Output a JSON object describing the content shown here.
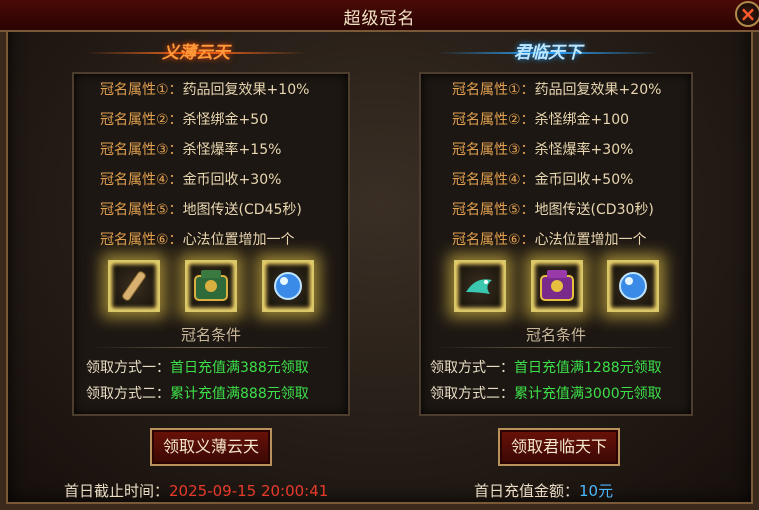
{
  "window": {
    "title": "超级冠名",
    "close_icon": "×"
  },
  "left": {
    "title": "义薄云天",
    "attributes": [
      {
        "label": "冠名属性①：",
        "value": "药品回复效果+10%"
      },
      {
        "label": "冠名属性②：",
        "value": "杀怪绑金+50"
      },
      {
        "label": "冠名属性③：",
        "value": "杀怪爆率+15%"
      },
      {
        "label": "冠名属性④：",
        "value": "金币回收+30%"
      },
      {
        "label": "冠名属性⑤：",
        "value": "地图传送(CD45秒)"
      },
      {
        "label": "冠名属性⑥：",
        "value": "心法位置增加一个"
      }
    ],
    "items": [
      "scroll-item-icon",
      "armor-chest-item-icon",
      "blue-orb-item-icon"
    ],
    "condition_title": "冠名条件",
    "claims": [
      {
        "label": "领取方式一：",
        "value": "首日充值满388元领取"
      },
      {
        "label": "领取方式二：",
        "value": "累计充值满888元领取"
      }
    ],
    "button": "领取义薄云天",
    "footer_label": "首日截止时间：",
    "footer_value": "2025-09-15 20:00:41"
  },
  "right": {
    "title": "君临天下",
    "attributes": [
      {
        "label": "冠名属性①：",
        "value": "药品回复效果+20%"
      },
      {
        "label": "冠名属性②：",
        "value": "杀怪绑金+100"
      },
      {
        "label": "冠名属性③：",
        "value": "杀怪爆率+30%"
      },
      {
        "label": "冠名属性④：",
        "value": "金币回收+50%"
      },
      {
        "label": "冠名属性⑤：",
        "value": "地图传送(CD30秒)"
      },
      {
        "label": "冠名属性⑥：",
        "value": "心法位置增加一个"
      }
    ],
    "items": [
      "dragon-item-icon",
      "purple-armor-item-icon",
      "blue-orb-item-icon"
    ],
    "condition_title": "冠名条件",
    "claims": [
      {
        "label": "领取方式一：",
        "value": "首日充值满1288元领取"
      },
      {
        "label": "领取方式二：",
        "value": "累计充值满3000元领取"
      }
    ],
    "button": "领取君临天下",
    "footer_label": "首日充值金额：",
    "footer_value": "10元"
  },
  "colors": {
    "attr_label": "#e0a050",
    "claim_value": "#3ce04a",
    "deadline": "#e83a2a",
    "amount": "#4ab8ff"
  }
}
